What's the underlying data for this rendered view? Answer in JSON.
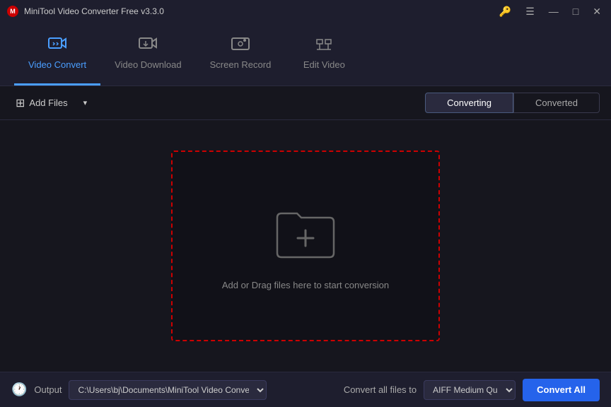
{
  "titleBar": {
    "title": "MiniTool Video Converter Free v3.3.0",
    "controls": {
      "settings": "⚙",
      "minimize": "—",
      "maximize": "□",
      "close": "✕"
    }
  },
  "nav": {
    "items": [
      {
        "id": "video-convert",
        "label": "Video Convert",
        "icon": "⇄",
        "active": true
      },
      {
        "id": "video-download",
        "label": "Video Download",
        "icon": "⬇",
        "active": false
      },
      {
        "id": "screen-record",
        "label": "Screen Record",
        "icon": "▶",
        "active": false
      },
      {
        "id": "edit-video",
        "label": "Edit Video",
        "icon": "✂",
        "active": false
      }
    ]
  },
  "toolbar": {
    "addFilesLabel": "Add Files",
    "tabs": [
      {
        "id": "converting",
        "label": "Converting",
        "active": true
      },
      {
        "id": "converted",
        "label": "Converted",
        "active": false
      }
    ]
  },
  "dropZone": {
    "text": "Add or Drag files here to start conversion"
  },
  "footer": {
    "outputLabel": "Output",
    "outputPath": "C:\\Users\\bj\\Documents\\MiniTool Video Converter\\output",
    "convertAllLabel": "Convert all files to",
    "formatValue": "AIFF Medium Qu",
    "convertAllBtn": "Convert All"
  }
}
